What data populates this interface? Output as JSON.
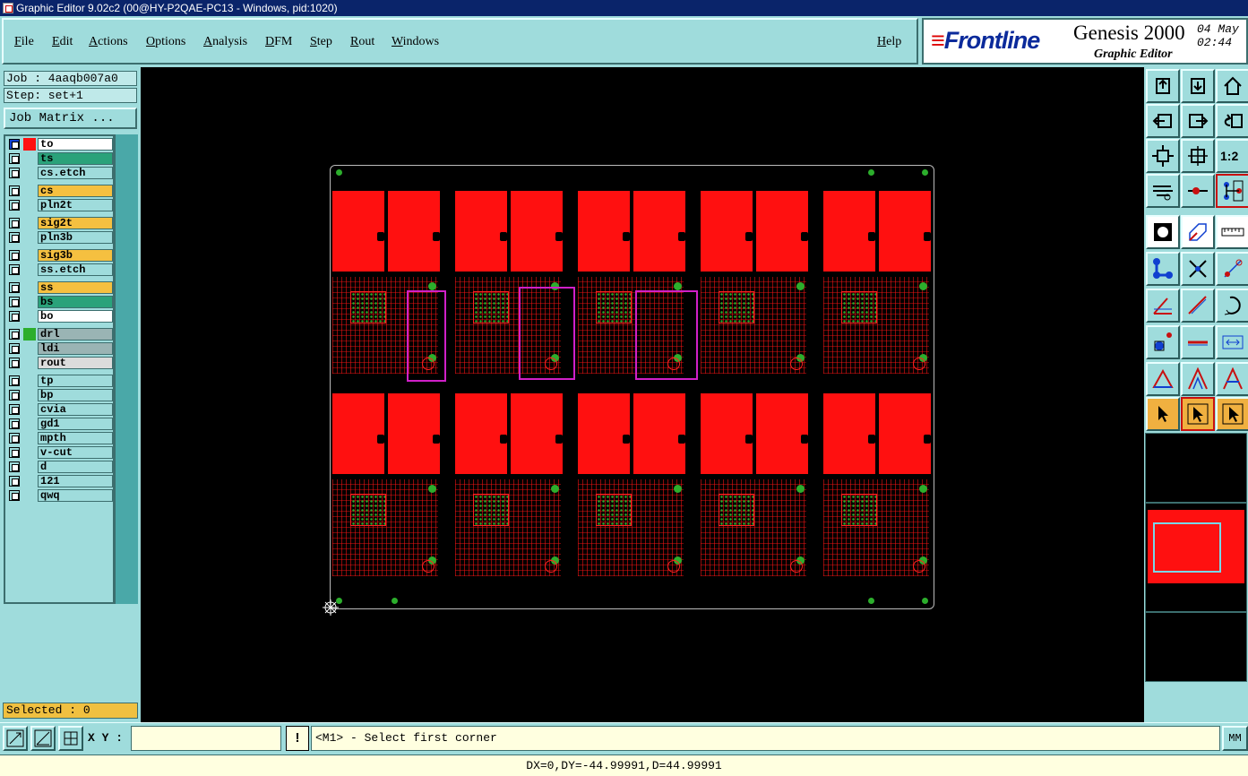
{
  "window": {
    "title": "Graphic Editor 9.02c2 (00@HY-P2QAE-PC13 - Windows, pid:1020)"
  },
  "menu": {
    "items": [
      "File",
      "Edit",
      "Actions",
      "Options",
      "Analysis",
      "DFM",
      "Step",
      "Rout",
      "Windows"
    ],
    "help": "Help"
  },
  "brand": {
    "logo": "Frontline",
    "product": "Genesis 2000",
    "subtitle": "Graphic Editor",
    "date": "04 May",
    "time": "02:44"
  },
  "left": {
    "job": "Job : 4aaqb007a0",
    "step": "Step: set+1",
    "job_matrix": "Job Matrix ...",
    "selected": "Selected : 0"
  },
  "layers": [
    {
      "name": "to",
      "bg": "#ffffff",
      "color": "#ff1010",
      "active": true
    },
    {
      "name": "ts",
      "bg": "#2aa27a",
      "color": ""
    },
    {
      "name": "cs.etch",
      "bg": "#9fdcdc",
      "color": ""
    },
    {
      "name": "cs",
      "bg": "#f5c040",
      "color": ""
    },
    {
      "name": "pln2t",
      "bg": "#9fdcdc",
      "color": ""
    },
    {
      "name": "sig2t",
      "bg": "#f5c040",
      "color": ""
    },
    {
      "name": "pln3b",
      "bg": "#9fdcdc",
      "color": ""
    },
    {
      "name": "sig3b",
      "bg": "#f5c040",
      "color": ""
    },
    {
      "name": "ss.etch",
      "bg": "#9fdcdc",
      "color": ""
    },
    {
      "name": "ss",
      "bg": "#f5c040",
      "color": ""
    },
    {
      "name": "bs",
      "bg": "#2aa27a",
      "color": ""
    },
    {
      "name": "bo",
      "bg": "#ffffff",
      "color": ""
    },
    {
      "name": "drl",
      "bg": "#9ab4b4",
      "color": "#2cae2c"
    },
    {
      "name": "ldi",
      "bg": "#9ab4b4",
      "color": ""
    },
    {
      "name": "rout",
      "bg": "#dcdcdc",
      "color": ""
    },
    {
      "name": "tp",
      "bg": "#9fdcdc",
      "color": ""
    },
    {
      "name": "bp",
      "bg": "#9fdcdc",
      "color": ""
    },
    {
      "name": "cvia",
      "bg": "#9fdcdc",
      "color": ""
    },
    {
      "name": "gd1",
      "bg": "#9fdcdc",
      "color": ""
    },
    {
      "name": "mpth",
      "bg": "#9fdcdc",
      "color": ""
    },
    {
      "name": "v-cut",
      "bg": "#9fdcdc",
      "color": ""
    },
    {
      "name": "d",
      "bg": "#9fdcdc",
      "color": ""
    },
    {
      "name": "121",
      "bg": "#9fdcdc",
      "color": ""
    },
    {
      "name": "qwq",
      "bg": "#9fdcdc",
      "color": ""
    }
  ],
  "toolbox": {
    "zoom_ratio_label": "1:2"
  },
  "bottom": {
    "xy_label": "X Y :",
    "xy_value": "",
    "excl": "!",
    "prompt": "<M1> - Select first corner",
    "units": "MM"
  },
  "status": {
    "text": "DX=0,DY=-44.99991,D=44.99991"
  },
  "colors": {
    "panel_bg": "#9fdcdc",
    "copper": "#ff1010",
    "drill": "#2cae2c",
    "selection": "#d020c8"
  }
}
